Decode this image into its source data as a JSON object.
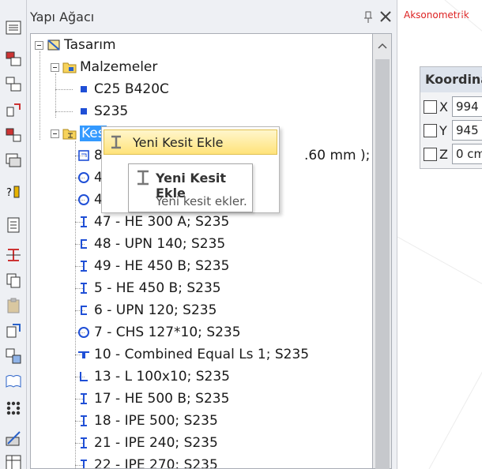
{
  "panel": {
    "title": "Yapı Ağacı"
  },
  "viewport": {
    "label": "Aksonometrik"
  },
  "coord": {
    "title": "Koordinat",
    "rows": [
      {
        "axis": "X",
        "value": "994"
      },
      {
        "axis": "Y",
        "value": "945"
      },
      {
        "axis": "Z",
        "value": "0 cm"
      }
    ]
  },
  "tree": {
    "root": "Tasarım",
    "materials": "Malzemeler",
    "material_items": [
      "C25 B420C",
      "S235"
    ],
    "sections_folder": "Kes",
    "partial_text": ".60 mm );",
    "items": [
      {
        "label": "8"
      },
      {
        "label": "4"
      },
      {
        "label": "4"
      },
      {
        "label": "47 - HE 300 A; S235"
      },
      {
        "label": "48 - UPN 140; S235"
      },
      {
        "label": "49 - HE 450 B; S235"
      },
      {
        "label": "5 - HE 450 B; S235"
      },
      {
        "label": "6 - UPN 120; S235"
      },
      {
        "label": "7 - CHS 127*10; S235"
      },
      {
        "label": "10 - Combined Equal Ls 1; S235"
      },
      {
        "label": "13 - L 100x10; S235"
      },
      {
        "label": "17 - HE 500 B; S235"
      },
      {
        "label": "18 - IPE 500; S235"
      },
      {
        "label": "21 - IPE 240; S235"
      },
      {
        "label": "22 - IPE 270; S235"
      }
    ]
  },
  "context_menu": {
    "item_label": "Yeni Kesit Ekle",
    "tooltip_title": "Yeni Kesit Ekle",
    "tooltip_desc": "Yeni kesit ekler."
  },
  "colors": {
    "accent": "#3399ff",
    "material_square": "#1f4fd6",
    "viewport_label": "#dd2222"
  }
}
